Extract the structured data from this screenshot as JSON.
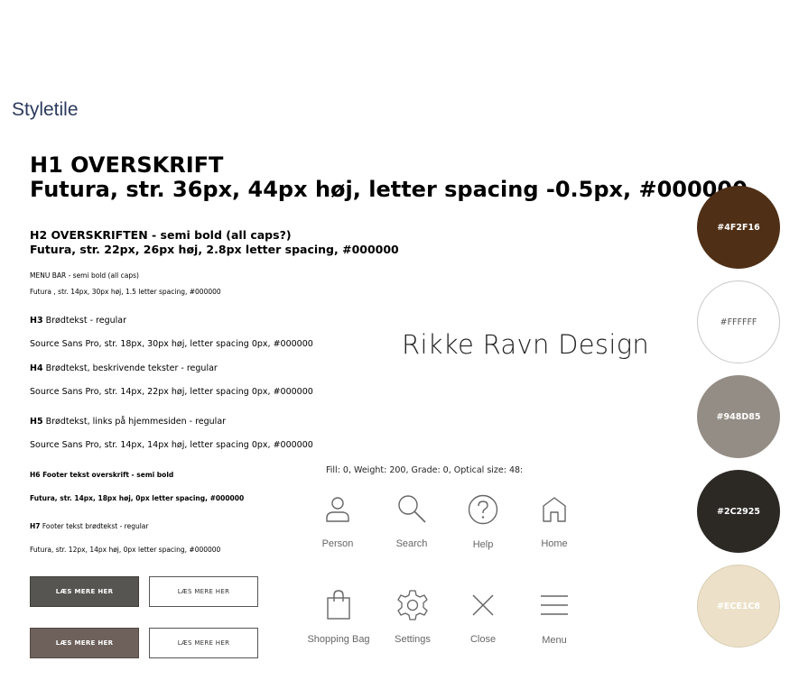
{
  "page_title": "Styletile",
  "h1": {
    "line1": "H1 OVERSKRIFT",
    "line2": "Futura, str. 36px, 44px høj, letter spacing -0.5px, #000000"
  },
  "h2": {
    "line1": "H2 OVERSKRIFTEN - semi bold (all caps?)",
    "line2": "Futura, str. 22px, 26px høj, 2.8px letter spacing, #000000"
  },
  "menu_bar": {
    "line1": "MENU BAR - semi bold (all caps)",
    "line2": "Futura , str. 14px, 30px høj, 1.5 letter spacing, #000000"
  },
  "h3": {
    "tag": "H3",
    "desc": " Brødtekst - regular",
    "spec": "Source Sans Pro, str. 18px, 30px høj,  letter spacing 0px, #000000"
  },
  "h4": {
    "tag": "H4",
    "desc": " Brødtekst, beskrivende tekster - regular",
    "spec": "Source Sans Pro, str. 14px, 22px høj,  letter spacing 0px, #000000"
  },
  "h5": {
    "tag": "H5",
    "desc": " Brødtekst, links på hjemmesiden - regular",
    "spec": "Source Sans Pro, str. 14px, 14px høj,  letter spacing 0px, #000000"
  },
  "h6": {
    "line1": "H6 Footer tekst overskrift - semi bold",
    "line2": "Futura, str. 14px, 18px høj, 0px letter spacing, #000000"
  },
  "h7": {
    "tag": "H7",
    "desc": " Footer tekst brødtekst - regular",
    "spec": "Futura, str. 12px, 14px høj, 0px letter spacing, #000000"
  },
  "buttons": {
    "label": "LÆS MERE HER"
  },
  "logo_text": "Rikke Ravn Design",
  "icons": {
    "caption": "Fill: 0, Weight: 200, Grade: 0, Optical size: 48:",
    "items": [
      {
        "name": "person-icon",
        "label": "Person"
      },
      {
        "name": "search-icon",
        "label": "Search"
      },
      {
        "name": "help-icon",
        "label": "Help"
      },
      {
        "name": "home-icon",
        "label": "Home"
      },
      {
        "name": "shopping-bag-icon",
        "label": "Shopping Bag"
      },
      {
        "name": "settings-icon",
        "label": "Settings"
      },
      {
        "name": "close-icon",
        "label": "Close"
      },
      {
        "name": "menu-icon",
        "label": "Menu"
      }
    ]
  },
  "swatches": [
    {
      "hex": "#4F2F16",
      "label": "#4F2F16",
      "text_color": "#ffffff"
    },
    {
      "hex": "#FFFFFF",
      "label": "#FFFFFF",
      "text_color": "#555555"
    },
    {
      "hex": "#948D85",
      "label": "#948D85",
      "text_color": "#ffffff"
    },
    {
      "hex": "#2C2925",
      "label": "#2C2925",
      "text_color": "#ffffff"
    },
    {
      "hex": "#ECE1C8",
      "label": "#ECE1C8",
      "text_color": "#ffffff"
    }
  ]
}
